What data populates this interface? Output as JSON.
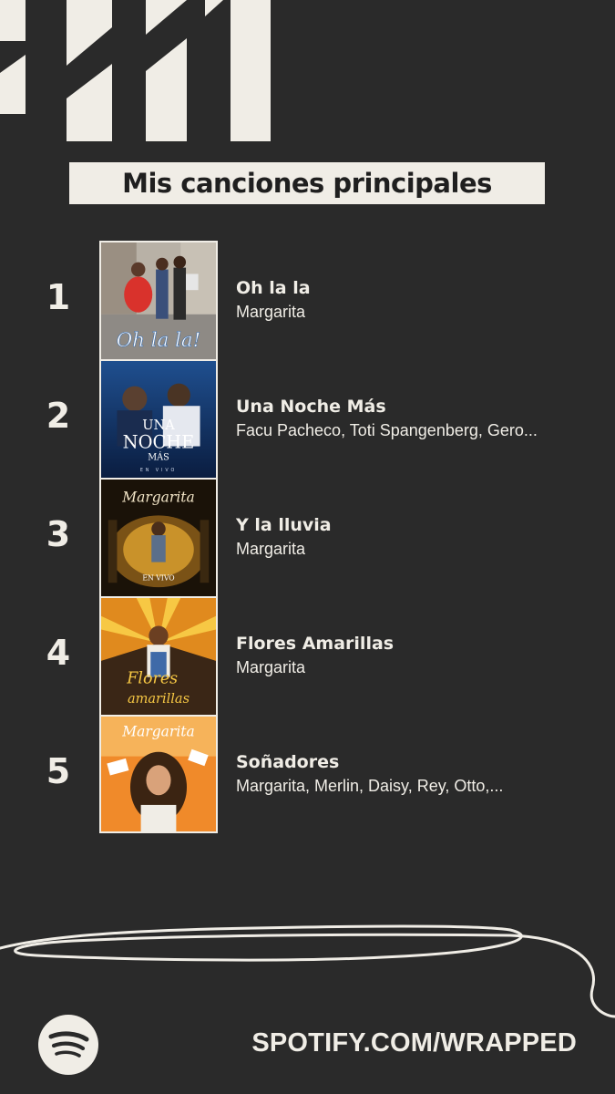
{
  "header": {
    "title": "Mis canciones principales"
  },
  "tracks": [
    {
      "rank": "1",
      "title": "Oh la la",
      "artist": "Margarita",
      "cover_text": "Oh la la!",
      "cover_colors": [
        "#b8b1a6",
        "#5a7fa8",
        "#d9322c"
      ]
    },
    {
      "rank": "2",
      "title": "Una Noche Más",
      "artist": "Facu Pacheco, Toti Spangenberg, Gero...",
      "cover_text_top": "UNA",
      "cover_text_mid": "NOCHE",
      "cover_text_bot": "MÁS",
      "cover_text_sub": "EN VIVO",
      "cover_colors": [
        "#0e2a5a",
        "#1f4f8f",
        "#e9eef7"
      ]
    },
    {
      "rank": "3",
      "title": "Y la lluvia",
      "artist": "Margarita",
      "cover_text_top": "Margarita",
      "cover_text_sub": "EN VIVO",
      "cover_colors": [
        "#1a1208",
        "#c9922a",
        "#f3d27a"
      ]
    },
    {
      "rank": "4",
      "title": "Flores Amarillas",
      "artist": "Margarita",
      "cover_text_top": "Flores",
      "cover_text_bot": "amarillas",
      "cover_colors": [
        "#e08a1e",
        "#f7c844",
        "#3a2616"
      ]
    },
    {
      "rank": "5",
      "title": "Soñadores",
      "artist": "Margarita, Merlin, Daisy, Rey, Otto,...",
      "cover_text_top": "Margarita",
      "cover_colors": [
        "#f08a2a",
        "#f6b35a",
        "#3b2412"
      ]
    }
  ],
  "footer": {
    "url": "SPOTIFY.COM/WRAPPED",
    "logo_icon": "spotify-icon"
  },
  "colors": {
    "background": "#2a2a2a",
    "cream": "#f0ede6",
    "dark_text": "#1f1f1f"
  }
}
